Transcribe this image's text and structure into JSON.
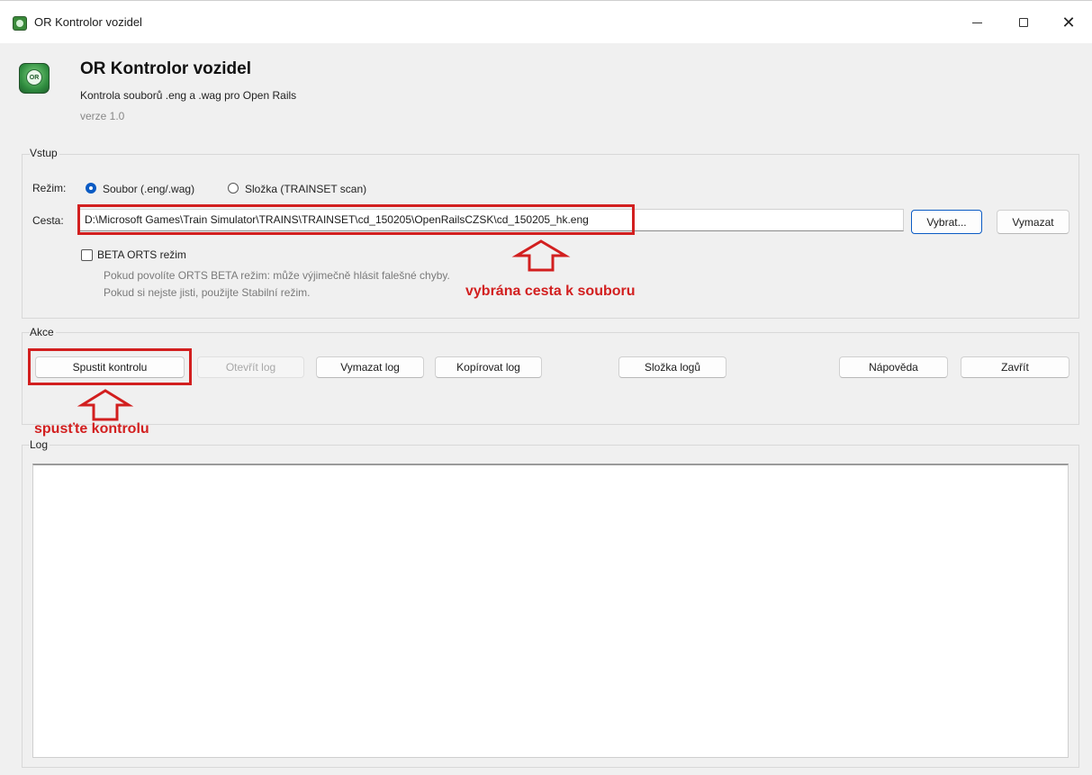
{
  "window": {
    "title": "OR Kontrolor vozidel"
  },
  "header": {
    "title": "OR Kontrolor vozidel",
    "subtitle": "Kontrola souborů .eng a .wag pro Open Rails",
    "version": "verze 1.0"
  },
  "input_group": {
    "label": "Vstup",
    "mode_label": "Režim:",
    "mode_file": "Soubor (.eng/.wag)",
    "mode_folder": "Složka (TRAINSET scan)",
    "mode_selected": "Soubor (.eng/.wag)",
    "path_label": "Cesta:",
    "path_value": "D:\\Microsoft Games\\Train Simulator\\TRAINS\\TRAINSET\\cd_150205\\OpenRailsCZSK\\cd_150205_hk.eng",
    "browse_button": "Vybrat...",
    "clear_button": "Vymazat",
    "beta_label": "BETA ORTS režim",
    "beta_checked": false,
    "hint_line1": "Pokud povolíte ORTS BETA režim: může výjimečně hlásit falešné chyby.",
    "hint_line2": "Pokud si nejste jisti, použijte Stabilní režim."
  },
  "actions_group": {
    "label": "Akce",
    "run": "Spustit kontrolu",
    "open_log": "Otevřít log",
    "clear_log": "Vymazat log",
    "copy_log": "Kopírovat log",
    "log_folder": "Složka logů",
    "help": "Nápověda",
    "close": "Zavřít"
  },
  "log_group": {
    "label": "Log",
    "content": ""
  },
  "annotations": {
    "path_note": "vybrána cesta k souboru",
    "run_note": "spusťte kontrolu",
    "color": "#d21f1f"
  }
}
